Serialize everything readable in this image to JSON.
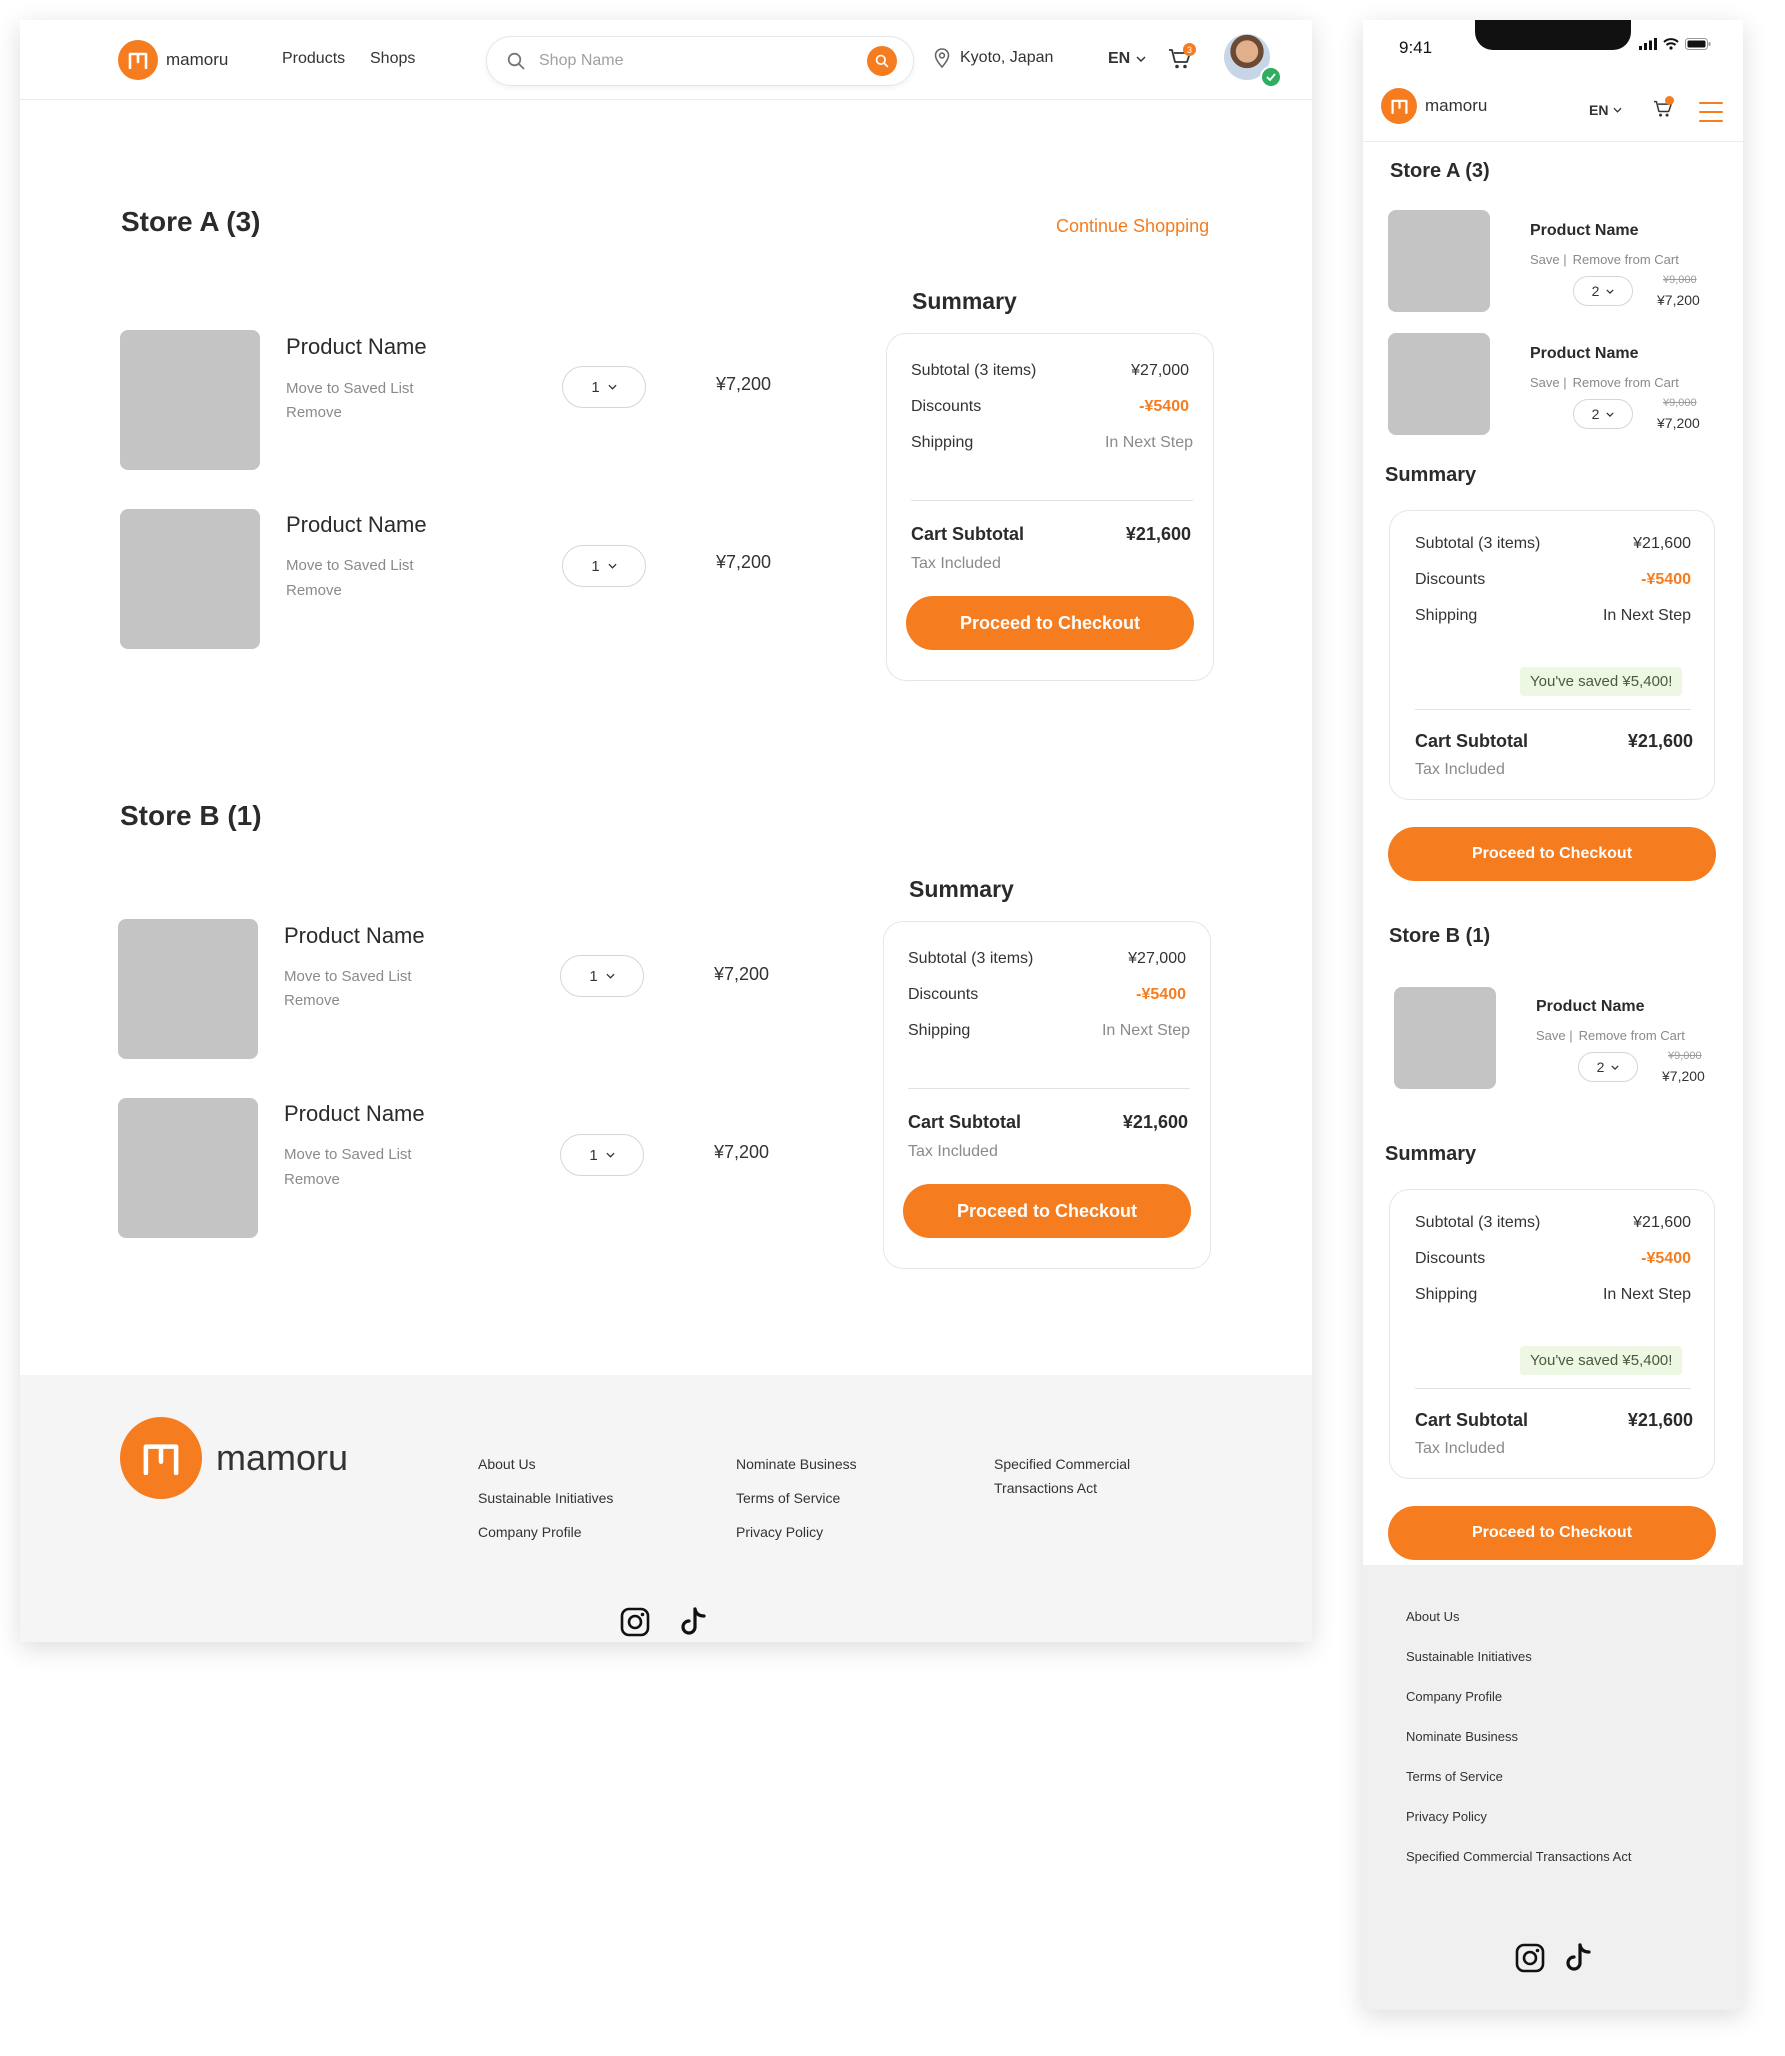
{
  "brand": {
    "name": "mamoru",
    "accent": "#f57c1f"
  },
  "desktop": {
    "nav": {
      "products": "Products",
      "shops": "Shops"
    },
    "search": {
      "placeholder": "Shop Name"
    },
    "location": "Kyoto, Japan",
    "language": "EN",
    "cart_count": "3",
    "continue_shopping": "Continue Shopping",
    "stores": [
      {
        "title": "Store A (3)",
        "items": [
          {
            "name": "Product Name",
            "move": "Move to Saved List",
            "remove": "Remove",
            "qty": "1",
            "price": "¥7,200"
          },
          {
            "name": "Product Name",
            "move": "Move to Saved List",
            "remove": "Remove",
            "qty": "1",
            "price": "¥7,200"
          }
        ],
        "summary": {
          "title": "Summary",
          "subtotal_label": "Subtotal (3 items)",
          "subtotal_value": "¥27,000",
          "discounts_label": "Discounts",
          "discounts_value": "-¥5400",
          "shipping_label": "Shipping",
          "shipping_value": "In Next Step",
          "cart_subtotal_label": "Cart Subtotal",
          "cart_subtotal_value": "¥21,600",
          "tax_note": "Tax Included",
          "checkout": "Proceed to Checkout"
        }
      },
      {
        "title": "Store B (1)",
        "items": [
          {
            "name": "Product Name",
            "move": "Move to Saved List",
            "remove": "Remove",
            "qty": "1",
            "price": "¥7,200"
          },
          {
            "name": "Product Name",
            "move": "Move to Saved List",
            "remove": "Remove",
            "qty": "1",
            "price": "¥7,200"
          }
        ],
        "summary": {
          "title": "Summary",
          "subtotal_label": "Subtotal (3 items)",
          "subtotal_value": "¥27,000",
          "discounts_label": "Discounts",
          "discounts_value": "-¥5400",
          "shipping_label": "Shipping",
          "shipping_value": "In Next Step",
          "cart_subtotal_label": "Cart Subtotal",
          "cart_subtotal_value": "¥21,600",
          "tax_note": "Tax Included",
          "checkout": "Proceed to Checkout"
        }
      }
    ],
    "footer": {
      "col1": [
        "About Us",
        "Sustainable Initiatives",
        "Company Profile"
      ],
      "col2": [
        "Nominate Business",
        "Terms of Service",
        "Privacy Policy"
      ],
      "col3": [
        "Specified Commercial",
        "Transactions Act"
      ]
    }
  },
  "mobile": {
    "status_time": "9:41",
    "language": "EN",
    "stores": [
      {
        "title": "Store A (3)",
        "items": [
          {
            "name": "Product Name",
            "save": "Save |",
            "remove": "Remove from Cart",
            "qty": "2",
            "old_price": "¥9,000",
            "price": "¥7,200"
          },
          {
            "name": "Product Name",
            "save": "Save |",
            "remove": "Remove from Cart",
            "qty": "2",
            "old_price": "¥9,000",
            "price": "¥7,200"
          }
        ],
        "summary": {
          "title": "Summary",
          "subtotal_label": "Subtotal (3 items)",
          "subtotal_value": "¥21,600",
          "discounts_label": "Discounts",
          "discounts_value": "-¥5400",
          "shipping_label": "Shipping",
          "shipping_value": "In Next Step",
          "saved": "You've saved ¥5,400!",
          "cart_subtotal_label": "Cart Subtotal",
          "cart_subtotal_value": "¥21,600",
          "tax_note": "Tax Included",
          "checkout": "Proceed to Checkout"
        }
      },
      {
        "title": "Store B (1)",
        "items": [
          {
            "name": "Product Name",
            "save": "Save |",
            "remove": "Remove from Cart",
            "qty": "2",
            "old_price": "¥9,000",
            "price": "¥7,200"
          }
        ],
        "summary": {
          "title": "Summary",
          "subtotal_label": "Subtotal (3 items)",
          "subtotal_value": "¥21,600",
          "discounts_label": "Discounts",
          "discounts_value": "-¥5400",
          "shipping_label": "Shipping",
          "shipping_value": "In Next Step",
          "saved": "You've saved ¥5,400!",
          "cart_subtotal_label": "Cart Subtotal",
          "cart_subtotal_value": "¥21,600",
          "tax_note": "Tax Included",
          "checkout": "Proceed to Checkout"
        }
      }
    ],
    "footer_links": [
      "About Us",
      "Sustainable Initiatives",
      "Company Profile",
      "Nominate Business",
      "Terms of Service",
      "Privacy Policy",
      "Specified Commercial Transactions Act"
    ]
  },
  "icons": {
    "search": "search-icon",
    "location": "location-pin-icon",
    "cart": "cart-icon",
    "chevron": "chevron-down-icon",
    "instagram": "instagram-icon",
    "tiktok": "tiktok-icon",
    "menu": "hamburger-menu-icon",
    "verified": "verified-check-icon"
  }
}
